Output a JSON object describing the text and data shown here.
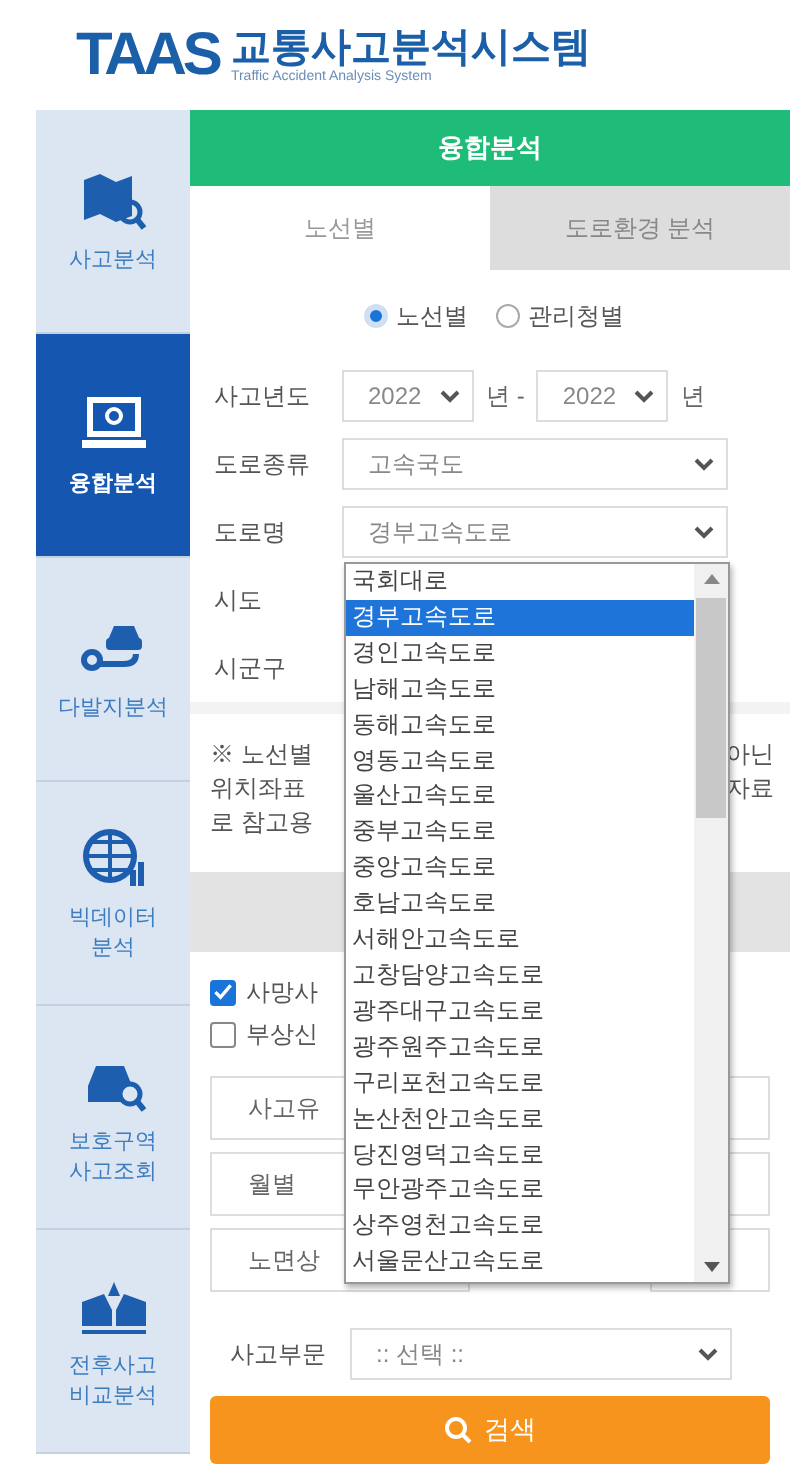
{
  "logo": {
    "mark": "TAAS",
    "title": "교통사고분석시스템",
    "subtitle": "Traffic Accident Analysis System"
  },
  "sidebar": {
    "items": [
      {
        "label": "사고분석",
        "selected": false
      },
      {
        "label": "융합분석",
        "selected": true
      },
      {
        "label": "다발지분석",
        "selected": false
      },
      {
        "label": "빅데이터 분석",
        "selected": false
      },
      {
        "label": "보호구역 사고조회",
        "selected": false
      },
      {
        "label": "전후사고 비교분석",
        "selected": false
      }
    ]
  },
  "panel": {
    "title": "융합분석",
    "tabs": [
      {
        "label": "노선별",
        "selected": true
      },
      {
        "label": "도로환경 분석",
        "selected": false
      }
    ],
    "radios": [
      {
        "label": "노선별",
        "selected": true
      },
      {
        "label": "관리청별",
        "selected": false
      }
    ],
    "fields": [
      {
        "kind": "range",
        "label": "사고년도",
        "from": "2022",
        "to": "2022",
        "unit_from": "년 -",
        "unit_to": "년"
      },
      {
        "kind": "select",
        "label": "도로종류",
        "value": "고속국도"
      },
      {
        "kind": "select",
        "label": "도로명",
        "value": "경부고속도로"
      },
      {
        "kind": "covered",
        "label": "시도"
      },
      {
        "kind": "covered",
        "label": "시군구"
      }
    ],
    "note": {
      "lines": [
        {
          "start": "※ 노선별",
          "end": "아닌"
        },
        {
          "start": "위치좌표",
          "end": "자료"
        },
        {
          "start": "로 참고용"
        }
      ]
    },
    "checks": [
      {
        "label": "사망사",
        "checked": true
      },
      {
        "label": "부상신",
        "checked": false
      }
    ],
    "filters": [
      "사고유",
      "월별",
      "노면상"
    ],
    "category": {
      "label": "사고부문",
      "placeholder": ":: 선택 ::"
    },
    "search_button": "검색"
  },
  "dropdown": {
    "options": [
      {
        "label": "국회대로",
        "selected": false
      },
      {
        "label": "경부고속도로",
        "selected": true
      },
      {
        "label": "경인고속도로",
        "selected": false
      },
      {
        "label": "남해고속도로",
        "selected": false
      },
      {
        "label": "동해고속도로",
        "selected": false
      },
      {
        "label": "영동고속도로",
        "selected": false
      },
      {
        "label": "울산고속도로",
        "selected": false
      },
      {
        "label": "중부고속도로",
        "selected": false
      },
      {
        "label": "중앙고속도로",
        "selected": false
      },
      {
        "label": "호남고속도로",
        "selected": false
      },
      {
        "label": "서해안고속도로",
        "selected": false
      },
      {
        "label": "고창담양고속도로",
        "selected": false
      },
      {
        "label": "광주대구고속도로",
        "selected": false
      },
      {
        "label": "광주원주고속도로",
        "selected": false
      },
      {
        "label": "구리포천고속도로",
        "selected": false
      },
      {
        "label": "논산천안고속도로",
        "selected": false
      },
      {
        "label": "당진영덕고속도로",
        "selected": false
      },
      {
        "label": "무안광주고속도로",
        "selected": false
      },
      {
        "label": "상주영천고속도로",
        "selected": false
      },
      {
        "label": "서울문산고속도로",
        "selected": false
      }
    ]
  }
}
